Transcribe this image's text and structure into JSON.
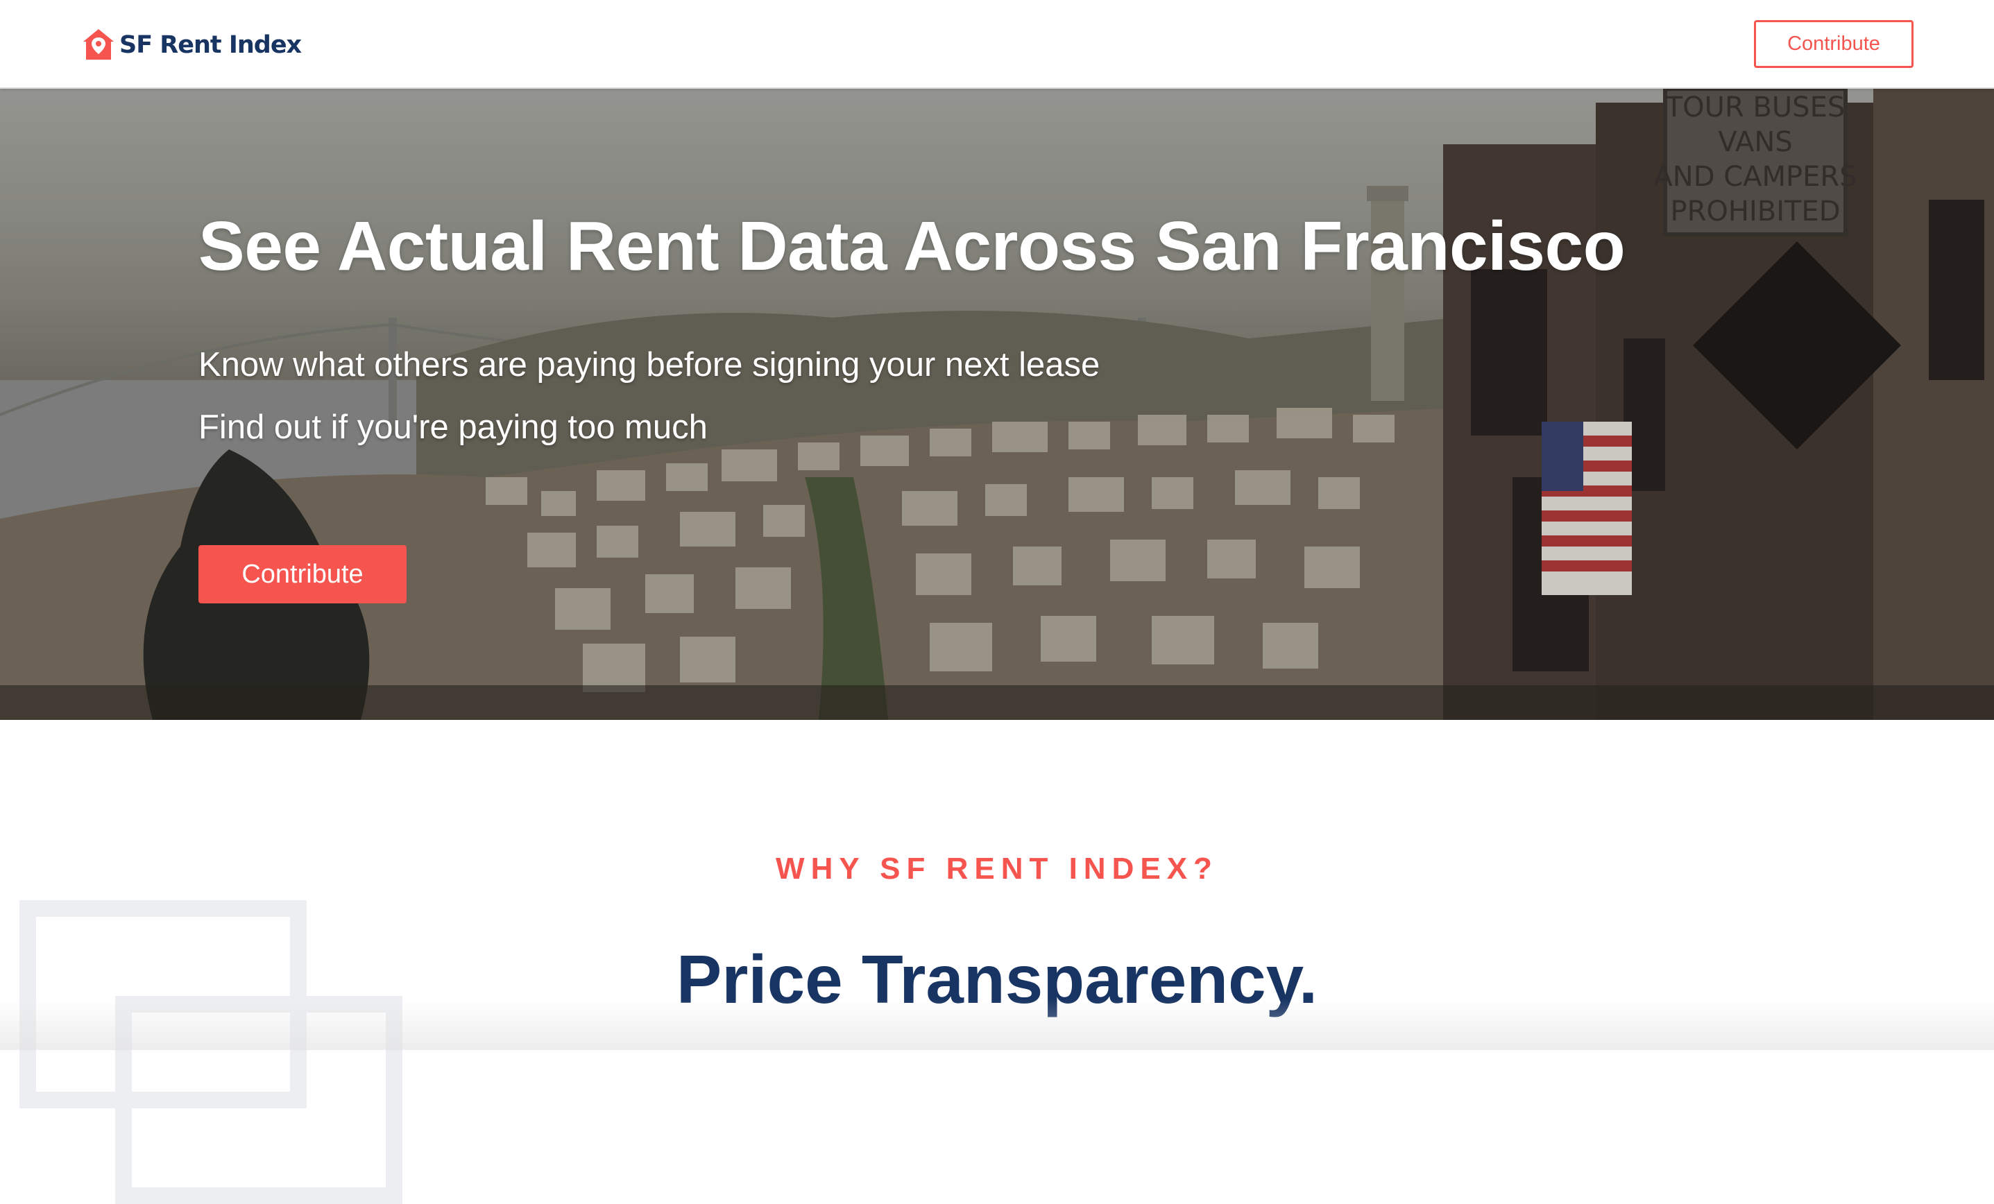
{
  "navbar": {
    "brand": "SF Rent Index",
    "contribute_label": "Contribute"
  },
  "hero": {
    "title": "See Actual Rent Data Across San Francisco",
    "subtitle_1": "Know what others are paying before signing your next lease",
    "subtitle_2": "Find out if you're paying too much",
    "contribute_label": "Contribute",
    "sign_text": "TOUR BUSES VANS AND CAMPERS PROHIBITED"
  },
  "why": {
    "label": "WHY SF RENT INDEX?",
    "title": "Price Transparency."
  },
  "colors": {
    "accent": "#f5554e",
    "brand": "#183463"
  },
  "icons": {
    "logo": "house-pin-icon"
  }
}
